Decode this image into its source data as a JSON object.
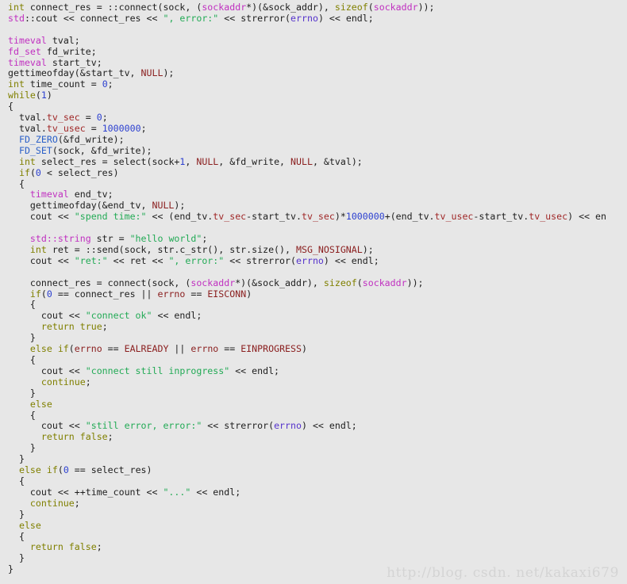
{
  "window": {
    "background_color": "#e7e7e7",
    "language": "C++"
  },
  "palette": {
    "keyword": "#808000",
    "type": "#c030c0",
    "macro_function": "#2b60c8",
    "constant": "#8b2020",
    "member": "#a02828",
    "number": "#2b3fd0",
    "string": "#22aa55",
    "variable": "#5533cc",
    "plain": "#202020",
    "watermark": "#d4d4d4"
  },
  "watermark": {
    "text": "http://blog. csdn. net/kakaxi679"
  },
  "code": {
    "lines": [
      [
        {
          "t": "int",
          "c": "kw"
        },
        {
          "t": " connect_res = ::connect(sock, (",
          "c": "pln"
        },
        {
          "t": "sockaddr",
          "c": "typ"
        },
        {
          "t": "*)(&sock_addr), ",
          "c": "pln"
        },
        {
          "t": "sizeof",
          "c": "kw"
        },
        {
          "t": "(",
          "c": "pln"
        },
        {
          "t": "sockaddr",
          "c": "typ"
        },
        {
          "t": "));",
          "c": "pln"
        }
      ],
      [
        {
          "t": "std",
          "c": "typ"
        },
        {
          "t": "::cout << connect_res << ",
          "c": "pln"
        },
        {
          "t": "\", error:\"",
          "c": "str"
        },
        {
          "t": " << strerror(",
          "c": "pln"
        },
        {
          "t": "errno",
          "c": "var"
        },
        {
          "t": ") << endl;",
          "c": "pln"
        }
      ],
      [],
      [
        {
          "t": "timeval",
          "c": "typ"
        },
        {
          "t": " tval;",
          "c": "pln"
        }
      ],
      [
        {
          "t": "fd_set",
          "c": "typ"
        },
        {
          "t": " fd_write;",
          "c": "pln"
        }
      ],
      [
        {
          "t": "timeval",
          "c": "typ"
        },
        {
          "t": " start_tv;",
          "c": "pln"
        }
      ],
      [
        {
          "t": "gettimeofday(&start_tv, ",
          "c": "pln"
        },
        {
          "t": "NULL",
          "c": "con"
        },
        {
          "t": ");",
          "c": "pln"
        }
      ],
      [
        {
          "t": "int",
          "c": "kw"
        },
        {
          "t": " time_count = ",
          "c": "pln"
        },
        {
          "t": "0",
          "c": "num"
        },
        {
          "t": ";",
          "c": "pln"
        }
      ],
      [
        {
          "t": "while",
          "c": "kw"
        },
        {
          "t": "(",
          "c": "pln"
        },
        {
          "t": "1",
          "c": "num"
        },
        {
          "t": ")",
          "c": "pln"
        }
      ],
      [
        {
          "t": "{",
          "c": "pln"
        }
      ],
      [
        {
          "t": "  tval.",
          "c": "pln"
        },
        {
          "t": "tv_sec",
          "c": "mem"
        },
        {
          "t": " = ",
          "c": "pln"
        },
        {
          "t": "0",
          "c": "num"
        },
        {
          "t": ";",
          "c": "pln"
        }
      ],
      [
        {
          "t": "  tval.",
          "c": "pln"
        },
        {
          "t": "tv_usec",
          "c": "mem"
        },
        {
          "t": " = ",
          "c": "pln"
        },
        {
          "t": "1000000",
          "c": "num"
        },
        {
          "t": ";",
          "c": "pln"
        }
      ],
      [
        {
          "t": "  ",
          "c": "pln"
        },
        {
          "t": "FD_ZERO",
          "c": "mac"
        },
        {
          "t": "(&fd_write);",
          "c": "pln"
        }
      ],
      [
        {
          "t": "  ",
          "c": "pln"
        },
        {
          "t": "FD_SET",
          "c": "mac"
        },
        {
          "t": "(sock, &fd_write);",
          "c": "pln"
        }
      ],
      [
        {
          "t": "  ",
          "c": "pln"
        },
        {
          "t": "int",
          "c": "kw"
        },
        {
          "t": " select_res = select(sock+",
          "c": "pln"
        },
        {
          "t": "1",
          "c": "num"
        },
        {
          "t": ", ",
          "c": "pln"
        },
        {
          "t": "NULL",
          "c": "con"
        },
        {
          "t": ", &fd_write, ",
          "c": "pln"
        },
        {
          "t": "NULL",
          "c": "con"
        },
        {
          "t": ", &tval);",
          "c": "pln"
        }
      ],
      [
        {
          "t": "  ",
          "c": "pln"
        },
        {
          "t": "if",
          "c": "kw"
        },
        {
          "t": "(",
          "c": "pln"
        },
        {
          "t": "0",
          "c": "num"
        },
        {
          "t": " < select_res)",
          "c": "pln"
        }
      ],
      [
        {
          "t": "  {",
          "c": "pln"
        }
      ],
      [
        {
          "t": "    ",
          "c": "pln"
        },
        {
          "t": "timeval",
          "c": "typ"
        },
        {
          "t": " end_tv;",
          "c": "pln"
        }
      ],
      [
        {
          "t": "    gettimeofday(&end_tv, ",
          "c": "pln"
        },
        {
          "t": "NULL",
          "c": "con"
        },
        {
          "t": ");",
          "c": "pln"
        }
      ],
      [
        {
          "t": "    cout << ",
          "c": "pln"
        },
        {
          "t": "\"spend time:\"",
          "c": "str"
        },
        {
          "t": " << (end_tv.",
          "c": "pln"
        },
        {
          "t": "tv_sec",
          "c": "mem"
        },
        {
          "t": "-start_tv.",
          "c": "pln"
        },
        {
          "t": "tv_sec",
          "c": "mem"
        },
        {
          "t": ")*",
          "c": "pln"
        },
        {
          "t": "1000000",
          "c": "num"
        },
        {
          "t": "+(end_tv.",
          "c": "pln"
        },
        {
          "t": "tv_usec",
          "c": "mem"
        },
        {
          "t": "-start_tv.",
          "c": "pln"
        },
        {
          "t": "tv_usec",
          "c": "mem"
        },
        {
          "t": ") << en",
          "c": "pln"
        }
      ],
      [],
      [
        {
          "t": "    ",
          "c": "pln"
        },
        {
          "t": "std::string",
          "c": "typ"
        },
        {
          "t": " str = ",
          "c": "pln"
        },
        {
          "t": "\"hello world\"",
          "c": "str"
        },
        {
          "t": ";",
          "c": "pln"
        }
      ],
      [
        {
          "t": "    ",
          "c": "pln"
        },
        {
          "t": "int",
          "c": "kw"
        },
        {
          "t": " ret = ::send(sock, str.c_str(), str.size(), ",
          "c": "pln"
        },
        {
          "t": "MSG_NOSIGNAL",
          "c": "con"
        },
        {
          "t": ");",
          "c": "pln"
        }
      ],
      [
        {
          "t": "    cout << ",
          "c": "pln"
        },
        {
          "t": "\"ret:\"",
          "c": "str"
        },
        {
          "t": " << ret << ",
          "c": "pln"
        },
        {
          "t": "\", error:\"",
          "c": "str"
        },
        {
          "t": " << strerror(",
          "c": "pln"
        },
        {
          "t": "errno",
          "c": "var"
        },
        {
          "t": ") << endl;",
          "c": "pln"
        }
      ],
      [],
      [
        {
          "t": "    connect_res = connect(sock, (",
          "c": "pln"
        },
        {
          "t": "sockaddr",
          "c": "typ"
        },
        {
          "t": "*)(&sock_addr), ",
          "c": "pln"
        },
        {
          "t": "sizeof",
          "c": "kw"
        },
        {
          "t": "(",
          "c": "pln"
        },
        {
          "t": "sockaddr",
          "c": "typ"
        },
        {
          "t": "));",
          "c": "pln"
        }
      ],
      [
        {
          "t": "    ",
          "c": "pln"
        },
        {
          "t": "if",
          "c": "kw"
        },
        {
          "t": "(",
          "c": "pln"
        },
        {
          "t": "0",
          "c": "num"
        },
        {
          "t": " == connect_res || ",
          "c": "pln"
        },
        {
          "t": "errno",
          "c": "con"
        },
        {
          "t": " == ",
          "c": "pln"
        },
        {
          "t": "EISCONN",
          "c": "con"
        },
        {
          "t": ")",
          "c": "pln"
        }
      ],
      [
        {
          "t": "    {",
          "c": "pln"
        }
      ],
      [
        {
          "t": "      cout << ",
          "c": "pln"
        },
        {
          "t": "\"connect ok\"",
          "c": "str"
        },
        {
          "t": " << endl;",
          "c": "pln"
        }
      ],
      [
        {
          "t": "      ",
          "c": "pln"
        },
        {
          "t": "return",
          "c": "kw"
        },
        {
          "t": " ",
          "c": "pln"
        },
        {
          "t": "true",
          "c": "kw"
        },
        {
          "t": ";",
          "c": "pln"
        }
      ],
      [
        {
          "t": "    }",
          "c": "pln"
        }
      ],
      [
        {
          "t": "    ",
          "c": "pln"
        },
        {
          "t": "else",
          "c": "kw"
        },
        {
          "t": " ",
          "c": "pln"
        },
        {
          "t": "if",
          "c": "kw"
        },
        {
          "t": "(",
          "c": "pln"
        },
        {
          "t": "errno",
          "c": "con"
        },
        {
          "t": " == ",
          "c": "pln"
        },
        {
          "t": "EALREADY",
          "c": "con"
        },
        {
          "t": " || ",
          "c": "pln"
        },
        {
          "t": "errno",
          "c": "con"
        },
        {
          "t": " == ",
          "c": "pln"
        },
        {
          "t": "EINPROGRESS",
          "c": "con"
        },
        {
          "t": ")",
          "c": "pln"
        }
      ],
      [
        {
          "t": "    {",
          "c": "pln"
        }
      ],
      [
        {
          "t": "      cout << ",
          "c": "pln"
        },
        {
          "t": "\"connect still inprogress\"",
          "c": "str"
        },
        {
          "t": " << endl;",
          "c": "pln"
        }
      ],
      [
        {
          "t": "      ",
          "c": "pln"
        },
        {
          "t": "continue",
          "c": "kw"
        },
        {
          "t": ";",
          "c": "pln"
        }
      ],
      [
        {
          "t": "    }",
          "c": "pln"
        }
      ],
      [
        {
          "t": "    ",
          "c": "pln"
        },
        {
          "t": "else",
          "c": "kw"
        }
      ],
      [
        {
          "t": "    {",
          "c": "pln"
        }
      ],
      [
        {
          "t": "      cout << ",
          "c": "pln"
        },
        {
          "t": "\"still error, error:\"",
          "c": "str"
        },
        {
          "t": " << strerror(",
          "c": "pln"
        },
        {
          "t": "errno",
          "c": "var"
        },
        {
          "t": ") << endl;",
          "c": "pln"
        }
      ],
      [
        {
          "t": "      ",
          "c": "pln"
        },
        {
          "t": "return",
          "c": "kw"
        },
        {
          "t": " ",
          "c": "pln"
        },
        {
          "t": "false",
          "c": "kw"
        },
        {
          "t": ";",
          "c": "pln"
        }
      ],
      [
        {
          "t": "    }",
          "c": "pln"
        }
      ],
      [
        {
          "t": "  }",
          "c": "pln"
        }
      ],
      [
        {
          "t": "  ",
          "c": "pln"
        },
        {
          "t": "else",
          "c": "kw"
        },
        {
          "t": " ",
          "c": "pln"
        },
        {
          "t": "if",
          "c": "kw"
        },
        {
          "t": "(",
          "c": "pln"
        },
        {
          "t": "0",
          "c": "num"
        },
        {
          "t": " == select_res)",
          "c": "pln"
        }
      ],
      [
        {
          "t": "  {",
          "c": "pln"
        }
      ],
      [
        {
          "t": "    cout << ++time_count << ",
          "c": "pln"
        },
        {
          "t": "\"...\"",
          "c": "str"
        },
        {
          "t": " << endl;",
          "c": "pln"
        }
      ],
      [
        {
          "t": "    ",
          "c": "pln"
        },
        {
          "t": "continue",
          "c": "kw"
        },
        {
          "t": ";",
          "c": "pln"
        }
      ],
      [
        {
          "t": "  }",
          "c": "pln"
        }
      ],
      [
        {
          "t": "  ",
          "c": "pln"
        },
        {
          "t": "else",
          "c": "kw"
        }
      ],
      [
        {
          "t": "  {",
          "c": "pln"
        }
      ],
      [
        {
          "t": "    ",
          "c": "pln"
        },
        {
          "t": "return",
          "c": "kw"
        },
        {
          "t": " ",
          "c": "pln"
        },
        {
          "t": "false",
          "c": "kw"
        },
        {
          "t": ";",
          "c": "pln"
        }
      ],
      [
        {
          "t": "  }",
          "c": "pln"
        }
      ],
      [
        {
          "t": "}",
          "c": "pln"
        }
      ]
    ]
  }
}
